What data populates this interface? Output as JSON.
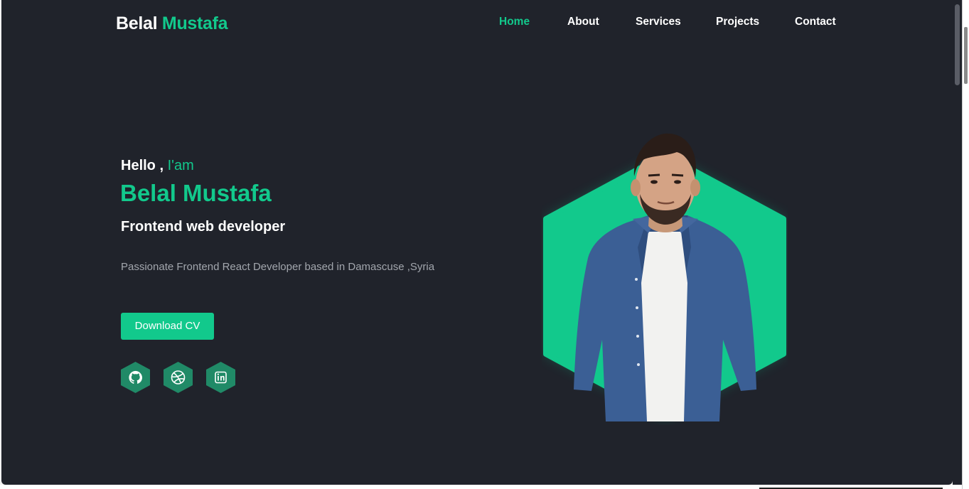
{
  "header": {
    "logo_first": "Belal",
    "logo_second": "Mustafa",
    "nav": [
      {
        "label": "Home",
        "active": true
      },
      {
        "label": "About",
        "active": false
      },
      {
        "label": "Services",
        "active": false
      },
      {
        "label": "Projects",
        "active": false
      },
      {
        "label": "Contact",
        "active": false
      }
    ]
  },
  "hero": {
    "greeting": "Hello ,",
    "greeting_accent": "I'am",
    "name": "Belal Mustafa",
    "role": "Frontend web developer",
    "description": "Passionate Frontend React Developer based in Damascuse ,Syria",
    "cv_button": "Download CV",
    "socials": [
      {
        "name": "github",
        "icon": "github-icon"
      },
      {
        "name": "dribbble",
        "icon": "dribbble-icon"
      },
      {
        "name": "linkedin",
        "icon": "linkedin-icon"
      }
    ]
  },
  "colors": {
    "background": "#20232b",
    "accent": "#12c98c",
    "social_bg": "#208a67",
    "text": "#ffffff",
    "muted": "#a2a6ad"
  }
}
